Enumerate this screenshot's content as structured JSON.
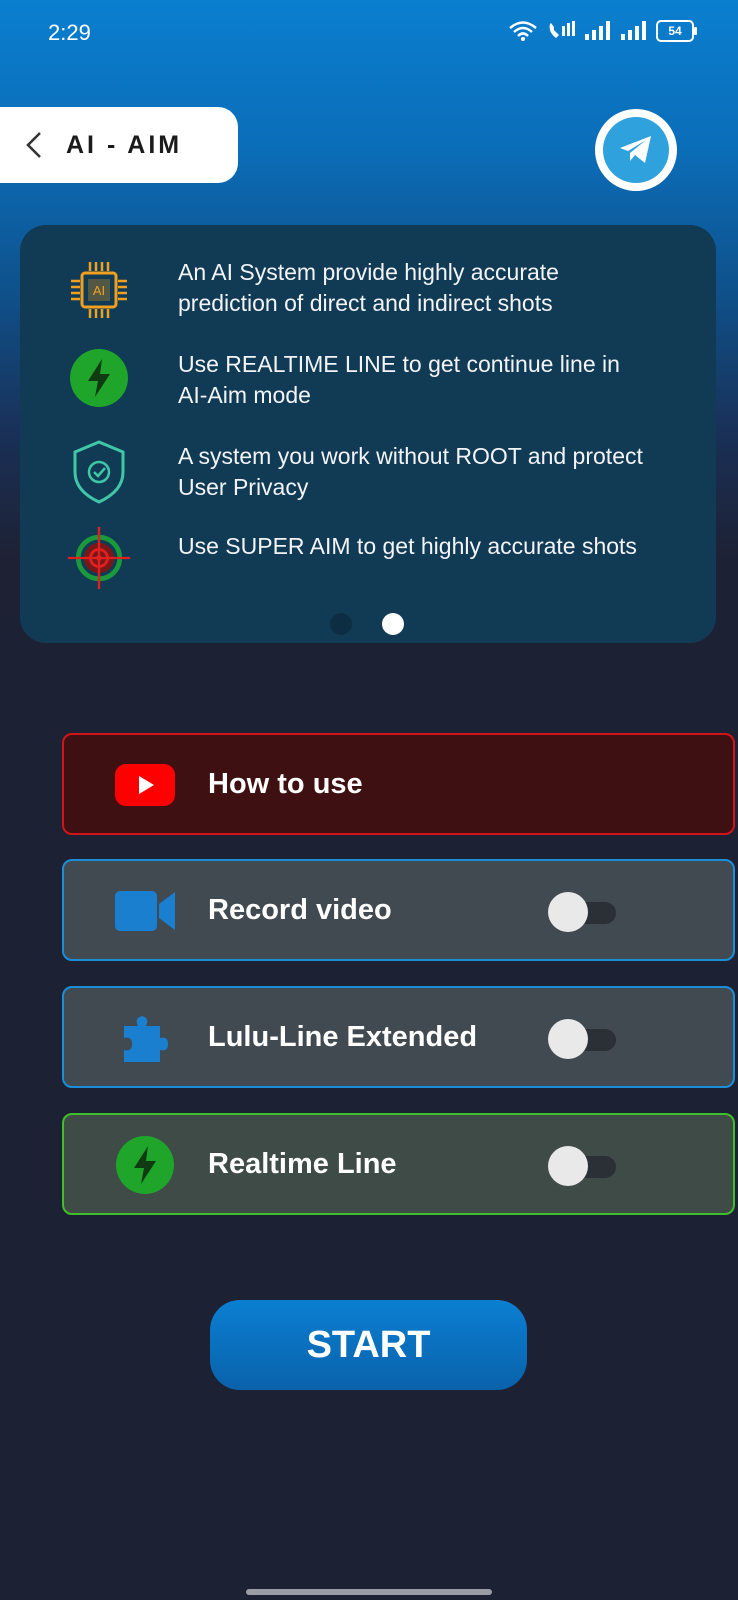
{
  "status_bar": {
    "time": "2:29",
    "battery": "54"
  },
  "header": {
    "title": "AI - AIM"
  },
  "features": [
    {
      "icon": "ai-chip-icon",
      "chip_label": "AI",
      "text": "An AI System provide highly accurate prediction of direct and indirect shots"
    },
    {
      "icon": "lightning-icon",
      "text": "Use REALTIME LINE to get continue line in AI-Aim mode"
    },
    {
      "icon": "shield-check-icon",
      "text": "A system you work without ROOT and protect User Privacy"
    },
    {
      "icon": "crosshair-icon",
      "text": "Use SUPER AIM to get highly accurate shots"
    }
  ],
  "carousel": {
    "pages": 2,
    "active": 2
  },
  "options": [
    {
      "label": "How to use",
      "icon": "youtube-icon",
      "has_toggle": false
    },
    {
      "label": "Record video",
      "icon": "video-camera-icon",
      "has_toggle": true,
      "enabled": false
    },
    {
      "label": "Lulu-Line Extended",
      "icon": "puzzle-icon",
      "has_toggle": true,
      "enabled": false
    },
    {
      "label": "Realtime Line",
      "icon": "lightning-icon",
      "has_toggle": true,
      "enabled": false
    }
  ],
  "start_label": "START",
  "colors": {
    "how_to_border": "#d0141a",
    "how_to_bg": "#3f1012",
    "blue_border": "#1a8fd8",
    "blue_bg": "#414a51",
    "green_border": "#3fbf2a",
    "green_bg": "#3f4b46",
    "accent": "#0b7fd2"
  }
}
